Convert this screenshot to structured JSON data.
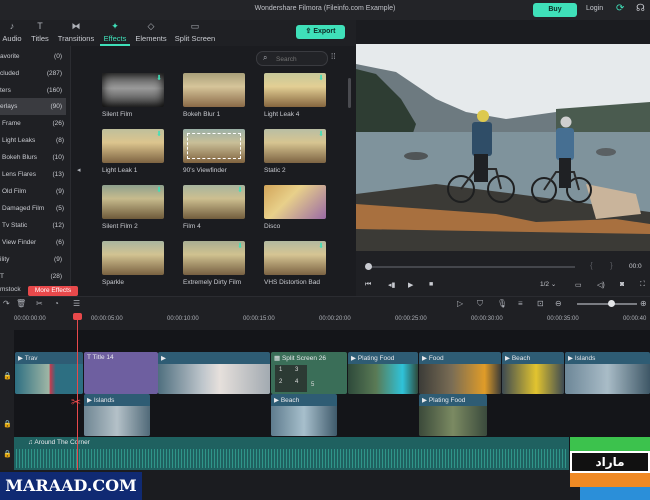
{
  "app": {
    "title": "Wondershare Filmora (Fileinfo.com Example)",
    "buy": "Buy",
    "login": "Login"
  },
  "tabs": [
    {
      "label": "Audio",
      "icon": "music-note-icon"
    },
    {
      "label": "Titles",
      "icon": "text-T-icon"
    },
    {
      "label": "Transitions",
      "icon": "transition-icon"
    },
    {
      "label": "Effects",
      "icon": "effects-sparkle-icon",
      "active": true
    },
    {
      "label": "Elements",
      "icon": "elements-icon"
    },
    {
      "label": "Split Screen",
      "icon": "split-screen-icon"
    }
  ],
  "export_label": "Export",
  "sidebar": {
    "items": [
      {
        "label": "avorite",
        "count": "(0)"
      },
      {
        "label": "cluded",
        "count": "(287)"
      },
      {
        "label": "ters",
        "count": "(160)"
      },
      {
        "label": "erlays",
        "count": "(90)",
        "active": true
      },
      {
        "label": "Frame",
        "count": "(26)"
      },
      {
        "label": "Light Leaks",
        "count": "(8)"
      },
      {
        "label": "Bokeh Blurs",
        "count": "(10)"
      },
      {
        "label": "Lens Flares",
        "count": "(13)"
      },
      {
        "label": "Old Film",
        "count": "(9)"
      },
      {
        "label": "Damaged Film",
        "count": "(5)"
      },
      {
        "label": "Tv Static",
        "count": "(12)"
      },
      {
        "label": "View Finder",
        "count": "(6)"
      },
      {
        "label": "ility",
        "count": "(9)"
      },
      {
        "label": "T",
        "count": "(28)"
      },
      {
        "label": "mstock",
        "count": ""
      }
    ],
    "more": "More Effects"
  },
  "search": {
    "placeholder": "Search"
  },
  "effects": [
    {
      "label": "Silent Film"
    },
    {
      "label": "Bokeh Blur 1"
    },
    {
      "label": "Light Leak 4"
    },
    {
      "label": "Light Leak 1"
    },
    {
      "label": "90's Viewfinder"
    },
    {
      "label": "Static 2"
    },
    {
      "label": "Silent Film 2"
    },
    {
      "label": "Film 4"
    },
    {
      "label": "Disco"
    },
    {
      "label": "Sparkle"
    },
    {
      "label": "Extremely Dirty Film"
    },
    {
      "label": "VHS Distortion Bad"
    }
  ],
  "player": {
    "time": "00:0",
    "ratio": "1/2"
  },
  "ruler": [
    "00:00:00:00",
    "00:00:05:00",
    "00:00:10:00",
    "00:00:15:00",
    "00:00:20:00",
    "00:00:25:00",
    "00:00:30:00",
    "00:00:35:00",
    "00:00:40"
  ],
  "clips": {
    "title14": "Title 14",
    "travel": "Trav",
    "split": "Split Screen 26",
    "split_cells": [
      "1",
      "2",
      "3",
      "4",
      "5"
    ],
    "food1": "Plating Food",
    "food2": "Food",
    "beach1": "Beach",
    "islands": "Islands",
    "beach2": "Beach",
    "food3": "Plating Food",
    "audio": "Around The Corner"
  },
  "watermark": {
    "left": "MARAAD.COM",
    "right": "ماراد"
  },
  "colors": {
    "accent": "#3fe0b9",
    "red": "#e8494b"
  }
}
